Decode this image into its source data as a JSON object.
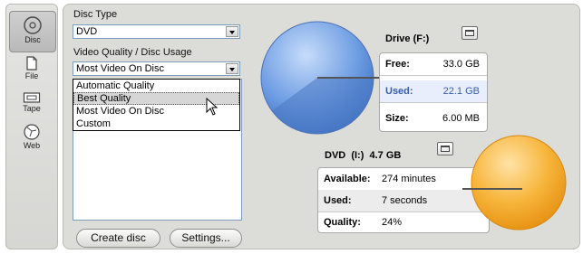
{
  "nav": {
    "items": [
      {
        "label": "Disc",
        "icon": "disc-icon"
      },
      {
        "label": "File",
        "icon": "file-icon"
      },
      {
        "label": "Tape",
        "icon": "tape-icon"
      },
      {
        "label": "Web",
        "icon": "web-icon"
      }
    ]
  },
  "disc_type": {
    "label": "Disc Type",
    "value": "DVD"
  },
  "video_quality": {
    "label": "Video Quality / Disc Usage",
    "value": "Most Video On Disc",
    "options": [
      "Automatic Quality",
      "Best Quality",
      "Most Video On Disc",
      "Custom"
    ],
    "highlighted": "Best Quality"
  },
  "buttons": {
    "create": "Create disc",
    "settings": "Settings..."
  },
  "drive": {
    "title": "Drive (F:)",
    "free_label": "Free:",
    "free_value": "33.0 GB",
    "used_label": "Used:",
    "used_value": "22.1 GB",
    "size_label": "Size:",
    "size_value": "6.00 MB",
    "used_fraction": 0.4
  },
  "dvd": {
    "title": "DVD  (I:)  4.7 GB",
    "available_label": "Available:",
    "available_value": "274 minutes",
    "used_label": "Used:",
    "used_value": "7 seconds",
    "quality_label": "Quality:",
    "quality_value": "24%"
  },
  "colors": {
    "drive_pie": "#5f8fd8",
    "dvd_pie": "#f5a623",
    "highlight": "#375cb0"
  }
}
